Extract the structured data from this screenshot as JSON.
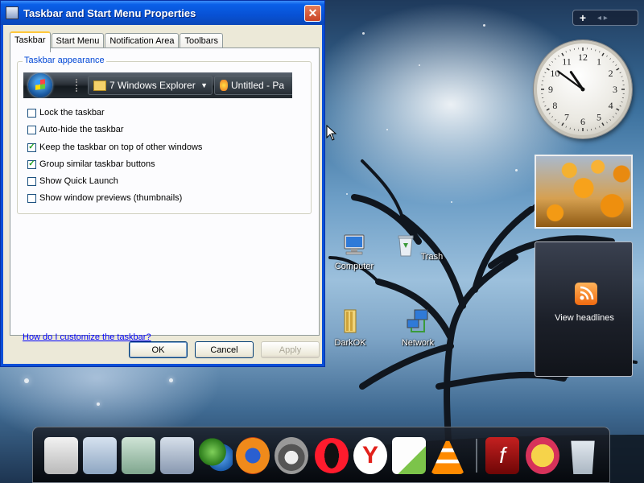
{
  "window": {
    "title": "Taskbar and Start Menu Properties",
    "close_symbol": "✕"
  },
  "tabs": [
    {
      "label": "Taskbar",
      "active": true
    },
    {
      "label": "Start Menu",
      "active": false
    },
    {
      "label": "Notification Area",
      "active": false
    },
    {
      "label": "Toolbars",
      "active": false
    }
  ],
  "taskbar_appearance": {
    "group_label": "Taskbar appearance",
    "preview": {
      "button1_label": "7 Windows Explorer",
      "button2_label": "Untitled - Pa"
    },
    "options": [
      {
        "label": "Lock the taskbar",
        "checked": false
      },
      {
        "label": "Auto-hide the taskbar",
        "checked": false
      },
      {
        "label": "Keep the taskbar on top of other windows",
        "checked": true
      },
      {
        "label": "Group similar taskbar buttons",
        "checked": true
      },
      {
        "label": "Show Quick Launch",
        "checked": false
      },
      {
        "label": "Show window previews (thumbnails)",
        "checked": false
      }
    ],
    "check_mark": "✓"
  },
  "help_link": "How do I customize the taskbar?",
  "buttons": {
    "ok": "OK",
    "cancel": "Cancel",
    "apply": "Apply"
  },
  "sidebar_gadgets": {
    "toolbar_plus": "+",
    "toolbar_nav": "◂ ▸",
    "clock_numbers": [
      "12",
      "1",
      "2",
      "3",
      "4",
      "5",
      "6",
      "7",
      "8",
      "9",
      "10",
      "11"
    ],
    "clock_time": {
      "hour": 10,
      "minute": 51
    },
    "feed_label": "View headlines"
  },
  "desktop_icons": [
    {
      "label": "Computer",
      "icon": "computer-icon"
    },
    {
      "label": "Trash",
      "icon": "trash-icon"
    },
    {
      "label": "DarkOK",
      "icon": "folder-icon"
    },
    {
      "label": "Network",
      "icon": "network-icon"
    }
  ],
  "dock_items": [
    "presentation-icon",
    "folder-icon",
    "pictures-folder-icon",
    "documents-folder-icon",
    "messenger-icon",
    "firefox-icon",
    "raccoon-icon",
    "opera-icon",
    "yandex-icon",
    "notepad-icon",
    "vlc-icon",
    "flash-icon",
    "pidgin-icon",
    "recycle-bin-icon"
  ],
  "colors": {
    "titlebar": "#0a5fe8",
    "dialog_bg": "#ece9d8",
    "link": "#0000ff",
    "group_label": "#0046d5",
    "tab_highlight": "#ffc83c"
  }
}
